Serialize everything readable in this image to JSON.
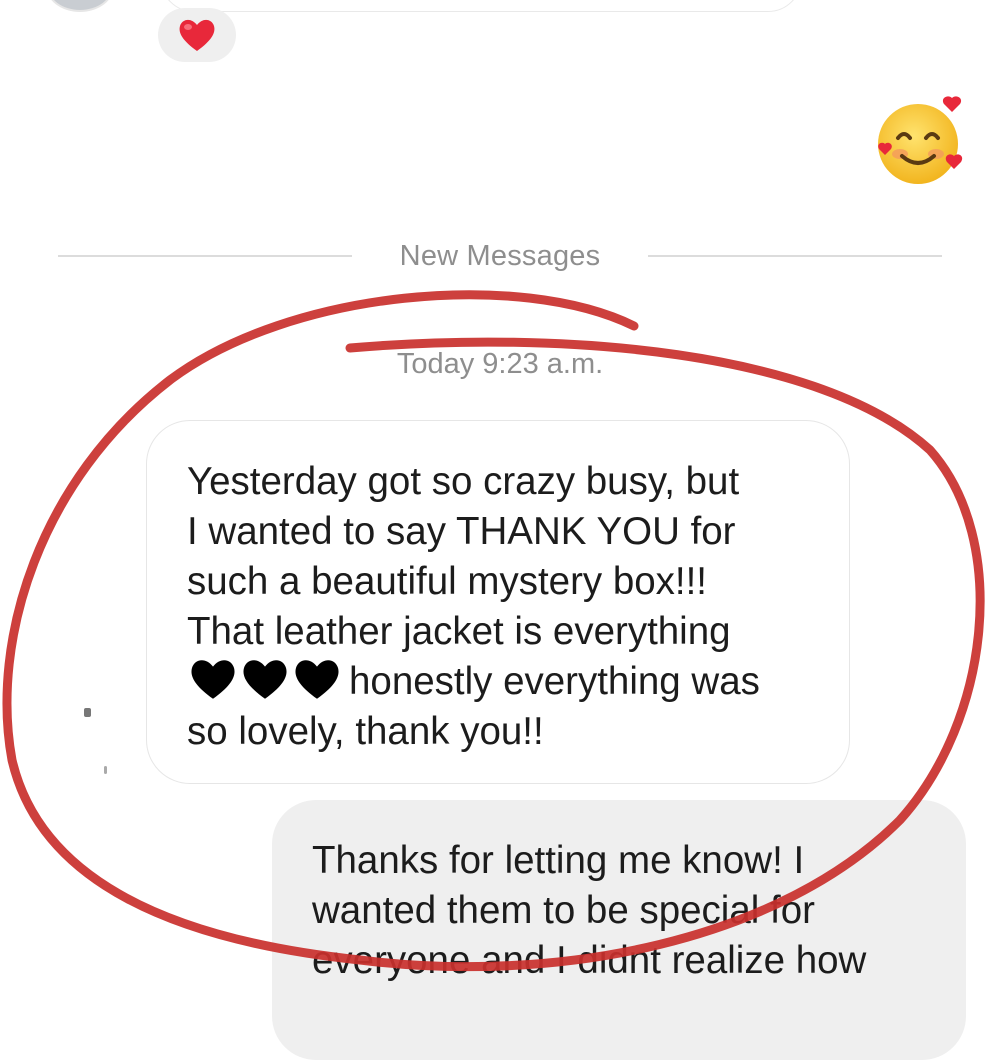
{
  "thread": {
    "divider_label": "New Messages",
    "timestamp": "Today 9:23 a.m."
  },
  "reaction": {
    "emoji_icon": "red-heart-icon"
  },
  "sent_emoji": {
    "icon": "smiling-face-with-hearts-icon"
  },
  "incoming_message": {
    "lines": [
      "Yesterday got so crazy busy,  but",
      "I wanted to say THANK YOU for",
      "such a beautiful mystery box!!!",
      "That leather jacket is everything"
    ],
    "hearts_icon": "black-heart-icon",
    "hearts_count": 3,
    "line5_text": "honestly everything was",
    "line6": "so lovely, thank you!!"
  },
  "outgoing_message": {
    "lines": [
      "Thanks for letting me know! I",
      "wanted them to be special for",
      "everyone and I didnt realize how"
    ]
  },
  "colors": {
    "annotation_circle": "#c9302c",
    "meta_text": "#8e8e8e",
    "outgoing_bubble": "#efefef"
  }
}
